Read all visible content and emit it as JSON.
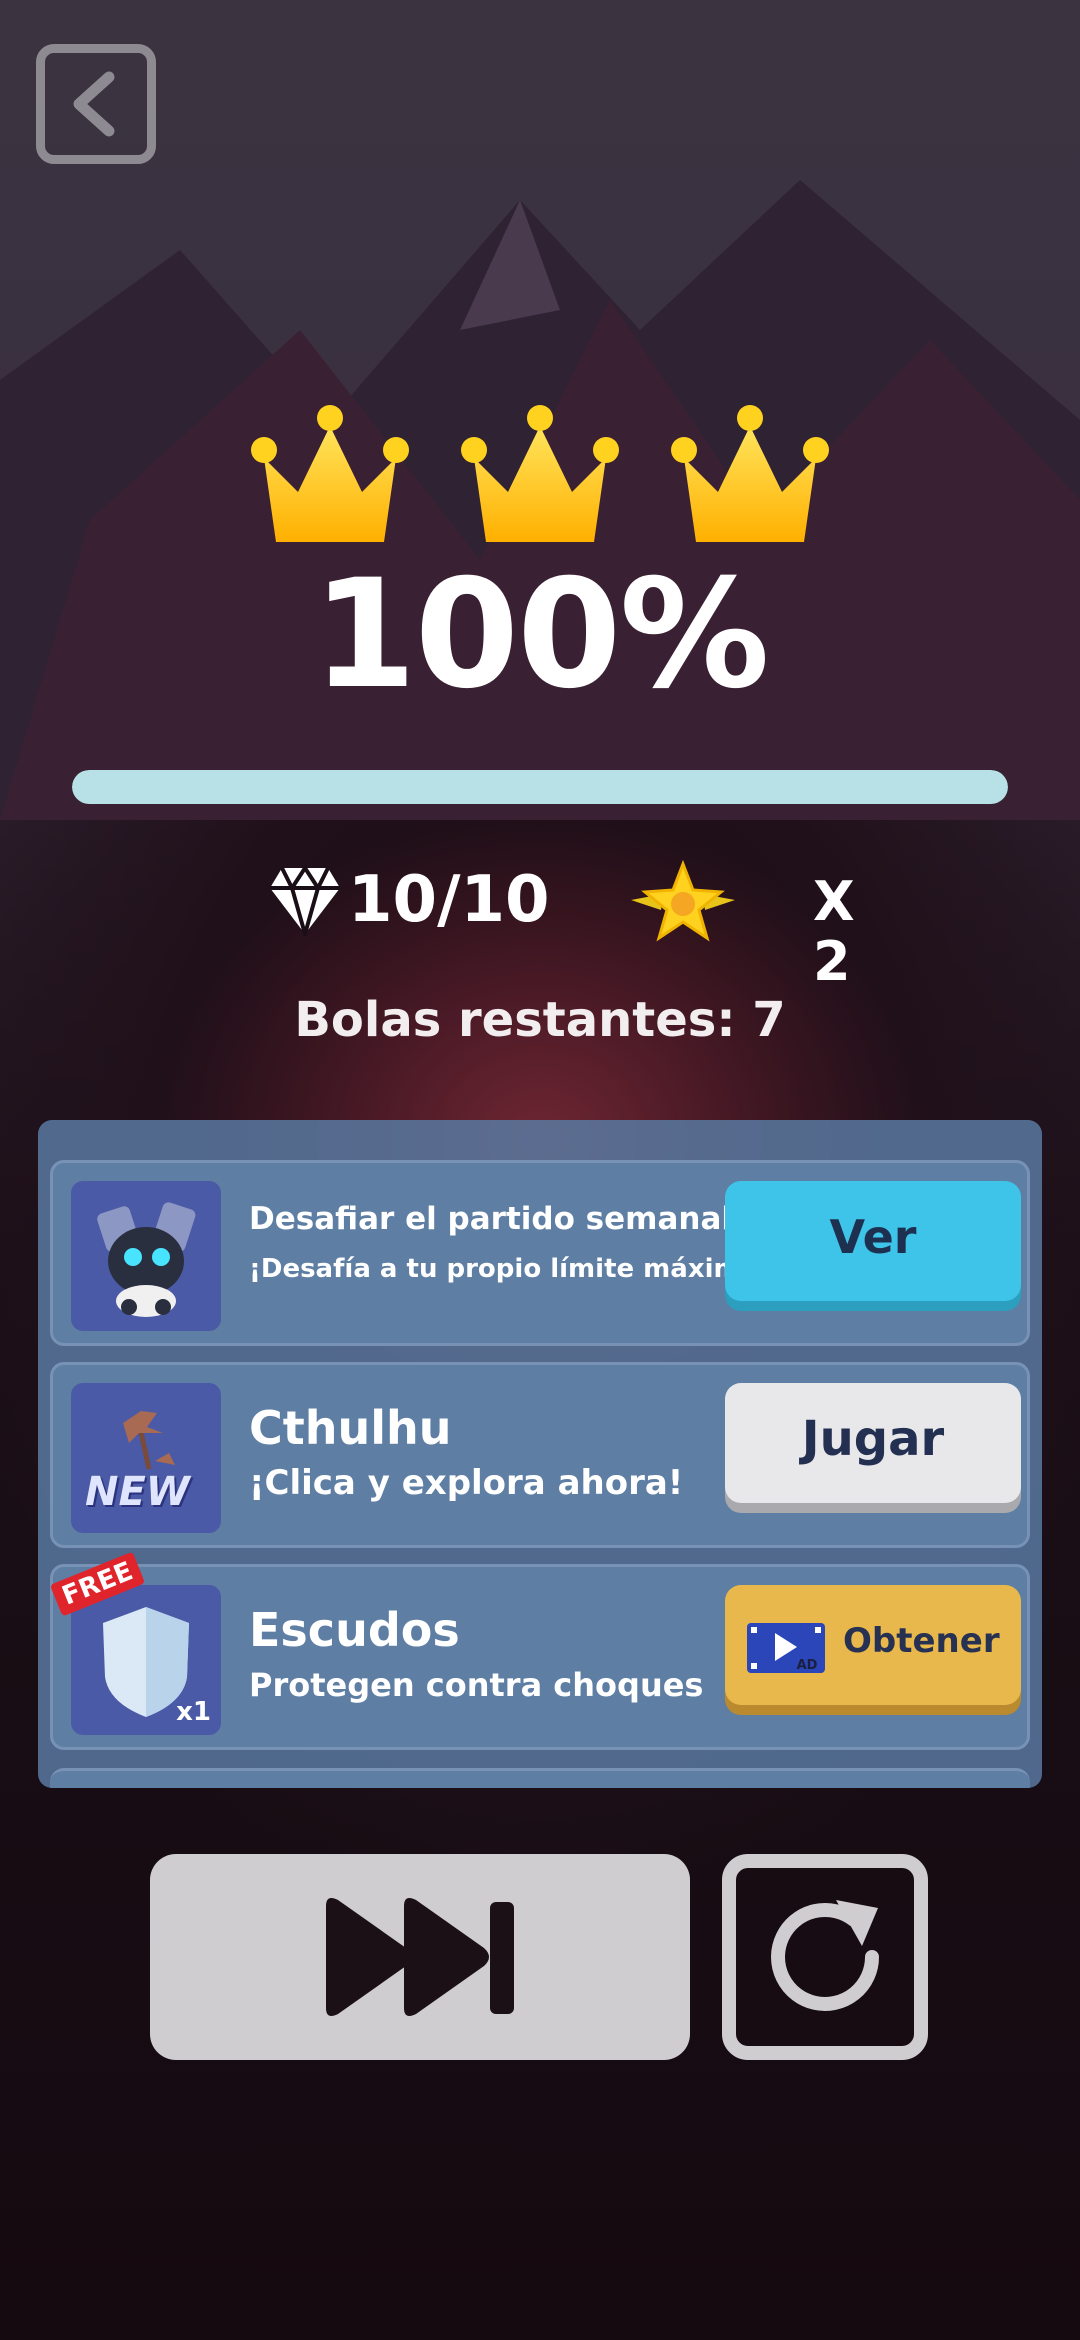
{
  "result": {
    "percent_text": "100%",
    "progress_fraction": 1.0,
    "crowns_earned": 3,
    "gems_text": "10/10",
    "multiplier_text": "X 2",
    "balls_left_text": "Bolas restantes: 7"
  },
  "offers": [
    {
      "title": "Desafiar el partido semanal",
      "subtitle": "¡Desafía a tu propio límite máximo!",
      "button_label": "Ver",
      "icon": "robot-icon"
    },
    {
      "title": "Cthulhu",
      "subtitle": "¡Clica y explora ahora!",
      "button_label": "Jugar",
      "icon": "new-map-icon",
      "badge": "NEW"
    },
    {
      "title": "Escudos",
      "subtitle": "Protegen contra choques",
      "button_label": "Obtener",
      "icon": "shield-icon",
      "tag": "FREE",
      "quantity": "x1",
      "button_icon": "video-ad-icon",
      "button_icon_label": "AD"
    }
  ],
  "colors": {
    "progress": "#b7e1e6",
    "ver_button": "#3ec4e8",
    "jugar_button": "#e8e8ea",
    "obtener_button": "#e9b84c",
    "crown": "#ffc61a"
  }
}
